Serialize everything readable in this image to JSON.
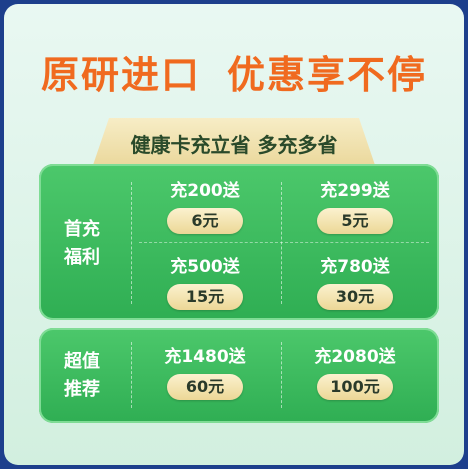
{
  "headline": {
    "left": "原研进口",
    "right": "优惠享不停"
  },
  "ribbon": "健康卡充立省 多充多省",
  "first_charge": {
    "label_line1": "首充",
    "label_line2": "福利",
    "offers": [
      {
        "title": "充200送",
        "bonus": "6元"
      },
      {
        "title": "充299送",
        "bonus": "5元"
      },
      {
        "title": "充500送",
        "bonus": "15元"
      },
      {
        "title": "充780送",
        "bonus": "30元"
      }
    ]
  },
  "recommended": {
    "label_line1": "超值",
    "label_line2": "推荐",
    "offers": [
      {
        "title": "充1480送",
        "bonus": "60元"
      },
      {
        "title": "充2080送",
        "bonus": "100元"
      }
    ]
  },
  "colors": {
    "border": "#1d3f8c",
    "headline": "#f06a1f",
    "panel": "#3bbb5e",
    "pill": "#f2e2a8"
  }
}
